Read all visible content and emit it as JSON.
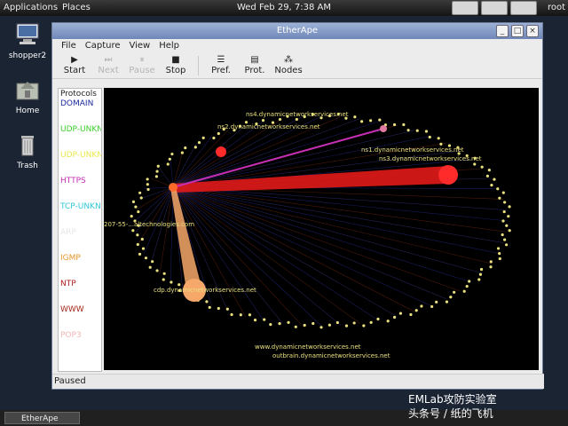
{
  "panel": {
    "applications": "Applications",
    "places": "Places",
    "clock": "Wed Feb 29,  7:38 AM",
    "user": "root"
  },
  "desktop": {
    "icons": [
      {
        "label": "shopper2",
        "icon": "computer-icon"
      },
      {
        "label": "Home",
        "icon": "home-folder-icon"
      },
      {
        "label": "Trash",
        "icon": "trash-icon"
      }
    ]
  },
  "window": {
    "title": "EtherApe",
    "menu": [
      "File",
      "Capture",
      "View",
      "Help"
    ],
    "toolbar": [
      {
        "label": "Start",
        "enabled": true
      },
      {
        "label": "Next",
        "enabled": false
      },
      {
        "label": "Pause",
        "enabled": false
      },
      {
        "label": "Stop",
        "enabled": true
      },
      {
        "label": "Pref.",
        "enabled": true
      },
      {
        "label": "Prot.",
        "enabled": true
      },
      {
        "label": "Nodes",
        "enabled": true
      }
    ],
    "protocols": {
      "header": "Protocols",
      "items": [
        {
          "name": "DOMAIN",
          "color": "#1c2a9e"
        },
        {
          "name": "UDP-UNKNOWN",
          "color": "#3bcf2c"
        },
        {
          "name": "UDP-UNKNOWN",
          "color": "#e9e84a"
        },
        {
          "name": "HTTPS",
          "color": "#c42fb3"
        },
        {
          "name": "TCP-UNKNOWN",
          "color": "#30c7d8"
        },
        {
          "name": "ARP",
          "color": "#e6e6e6"
        },
        {
          "name": "IGMP",
          "color": "#e6962a"
        },
        {
          "name": "NTP",
          "color": "#b01e1e"
        },
        {
          "name": "WWW",
          "color": "#a3291a"
        },
        {
          "name": "POP3",
          "color": "#f2b6b6"
        }
      ]
    },
    "graph_labels": [
      "ns4.dynamicnetworkservices.net",
      "ns2.dynamicnetworkservices.net",
      "ns1.dynamicnetworkservices.net",
      "ns3.dynamicnetworkservices.net",
      "207-55-...altechnologies.com",
      "cdp.dynamicnetworkservices.net",
      "outbrain.dynamicnetworkservices.net",
      "www.dynamicnetworkservices.net"
    ],
    "status": "Paused"
  },
  "taskbar": {
    "item": "EtherApe"
  },
  "watermark": {
    "line1": "EMLab攻防实验室",
    "line2": "头条号 / 纸的飞机"
  },
  "colors": {
    "background": "#000000",
    "label": "#e9e07e",
    "node_red": "#ff2a2a",
    "node_orange": "#f6a86a"
  }
}
